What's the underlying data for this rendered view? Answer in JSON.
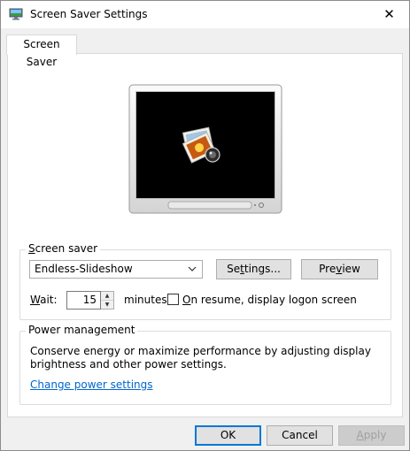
{
  "window": {
    "title": "Screen Saver Settings",
    "close_glyph": "✕"
  },
  "tab": {
    "label": "Screen Saver"
  },
  "screen_saver": {
    "group_label": "Screen saver",
    "selected": "Endless-Slideshow",
    "settings_label": "Settings...",
    "preview_label": "Preview",
    "wait_label": "Wait:",
    "wait_value": "15",
    "minutes_label": "minutes",
    "resume_label": "On resume, display logon screen",
    "resume_checked": false
  },
  "power": {
    "group_label": "Power management",
    "description_line1": "Conserve energy or maximize performance by adjusting display",
    "description_line2": "brightness and other power settings.",
    "link_label": "Change power settings"
  },
  "footer": {
    "ok_label": "OK",
    "cancel_label": "Cancel",
    "apply_label": "Apply"
  },
  "colors": {
    "link": "#0066cc",
    "focus_border": "#0078d7",
    "screen": "#000000"
  },
  "icons": {
    "app": "monitor-settings-icon",
    "preview": "photo-slideshow-icon"
  }
}
